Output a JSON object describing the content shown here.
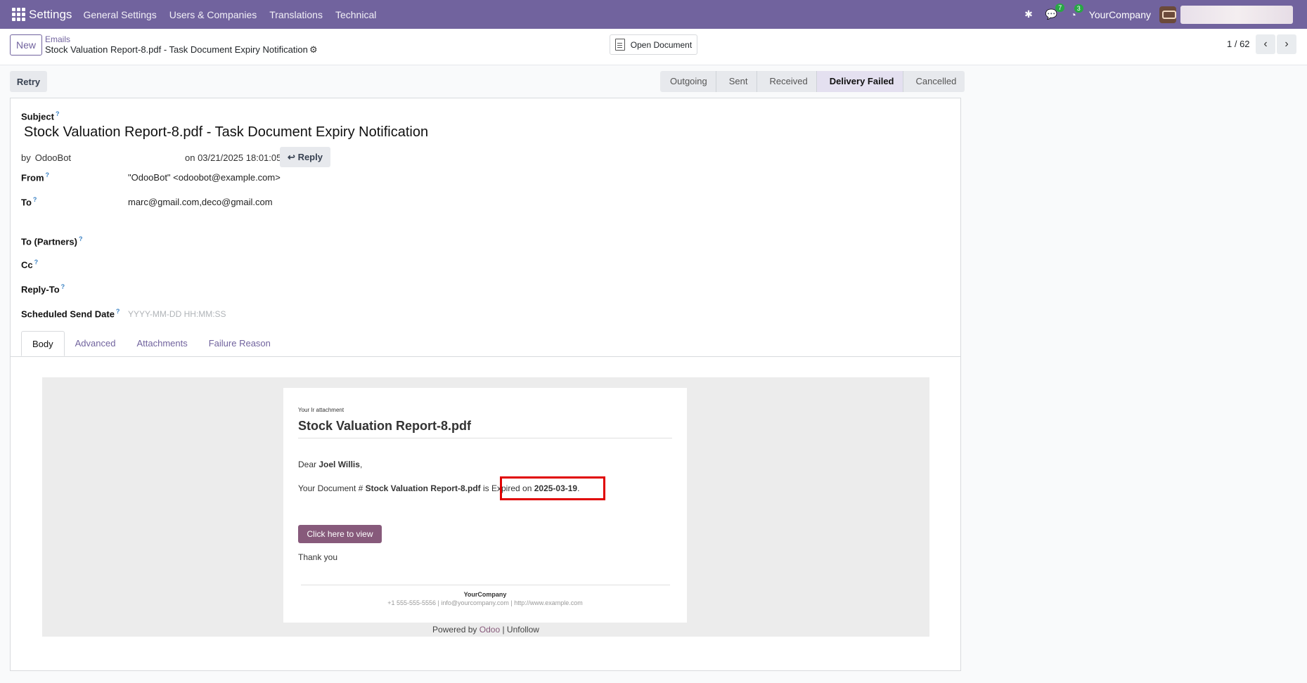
{
  "navbar": {
    "app_name": "Settings",
    "menus": [
      "General Settings",
      "Users & Companies",
      "Translations",
      "Technical"
    ],
    "messages_count": "7",
    "activities_count": "3",
    "company": "YourCompany"
  },
  "control_panel": {
    "new_label": "New",
    "breadcrumb_parent": "Emails",
    "breadcrumb_current": "Stock Valuation Report-8.pdf - Task Document Expiry Notification",
    "open_document_label": "Open Document",
    "pager": "1 / 62"
  },
  "actions": {
    "retry_label": "Retry"
  },
  "statusbar": {
    "stages": [
      "Outgoing",
      "Sent",
      "Received",
      "Delivery Failed",
      "Cancelled"
    ],
    "active": "Delivery Failed"
  },
  "form": {
    "subject_label": "Subject",
    "subject": "Stock Valuation Report-8.pdf - Task Document Expiry Notification",
    "by_prefix": "by",
    "author": "OdooBot",
    "date": "on 03/21/2025 18:01:05",
    "reply_label": "Reply",
    "from_label": "From",
    "from_value": "\"OdooBot\" <odoobot@example.com>",
    "to_label": "To",
    "to_value": "marc@gmail.com,deco@gmail.com",
    "to_partners_label": "To (Partners)",
    "cc_label": "Cc",
    "reply_to_label": "Reply-To",
    "scheduled_label": "Scheduled Send Date",
    "scheduled_placeholder": "YYYY-MM-DD HH:MM:SS",
    "help_mark": "?"
  },
  "tabs": [
    "Body",
    "Advanced",
    "Attachments",
    "Failure Reason"
  ],
  "email_body": {
    "small_label": "Your Ir attachment",
    "title": "Stock Valuation Report-8.pdf",
    "dear": "Dear",
    "recipient": "Joel Willis",
    "doc_prefix": "Your Document #",
    "doc_name": "Stock Valuation Report-8.pdf",
    "is_text": "is",
    "expired_text": "Expired on",
    "expired_date": "2025-03-19",
    "button_label": "Click here to view",
    "thanks": "Thank you",
    "footer_company": "YourCompany",
    "footer_contact": "+1 555-555-5556 | info@yourcompany.com | http://www.example.com",
    "powered_by": "Powered by",
    "odoo": "Odoo",
    "unfollow": "| Unfollow"
  },
  "colors": {
    "navbar": "#71639e",
    "button_view": "#875a7b",
    "highlight_box": "#e00000"
  }
}
